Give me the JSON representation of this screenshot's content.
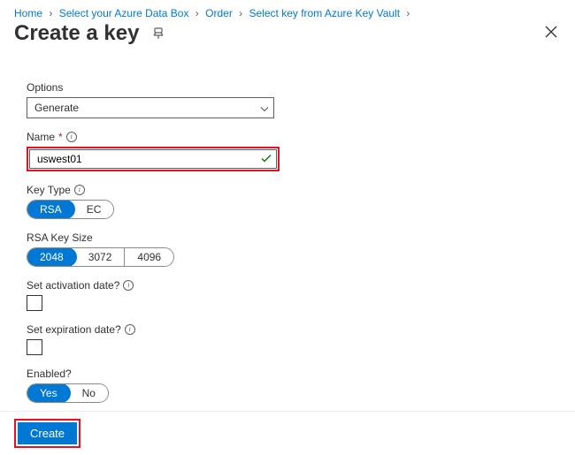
{
  "breadcrumb": {
    "items": [
      "Home",
      "Select your Azure Data Box",
      "Order",
      "Select key from Azure Key Vault"
    ]
  },
  "page": {
    "title": "Create a key"
  },
  "form": {
    "options": {
      "label": "Options",
      "value": "Generate"
    },
    "name": {
      "label": "Name",
      "value": "uswest01"
    },
    "key_type": {
      "label": "Key Type",
      "opts": [
        "RSA",
        "EC"
      ],
      "selected": "RSA"
    },
    "rsa_size": {
      "label": "RSA Key Size",
      "opts": [
        "2048",
        "3072",
        "4096"
      ],
      "selected": "2048"
    },
    "activation": {
      "label": "Set activation date?"
    },
    "expiration": {
      "label": "Set expiration date?"
    },
    "enabled": {
      "label": "Enabled?",
      "opts": [
        "Yes",
        "No"
      ],
      "selected": "Yes"
    }
  },
  "footer": {
    "create": "Create"
  },
  "i18n": {
    "info": "i"
  }
}
